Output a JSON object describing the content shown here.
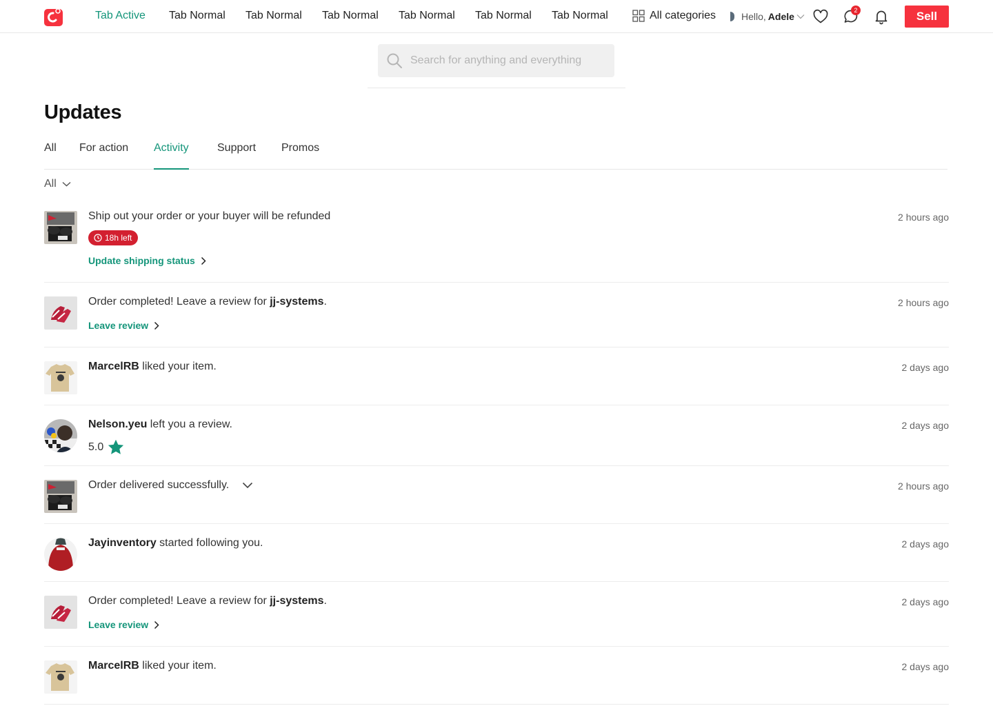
{
  "nav": {
    "tabs": [
      "Tab Active",
      "Tab Normal",
      "Tab Normal",
      "Tab Normal",
      "Tab Normal",
      "Tab Normal",
      "Tab Normal"
    ],
    "categories_label": "All categories",
    "hello_prefix": "Hello,",
    "user_name": "Adele",
    "chat_badge": "2",
    "sell_label": "Sell"
  },
  "search": {
    "placeholder": "Search for anything and everything"
  },
  "page": {
    "title": "Updates",
    "tabs": [
      "All",
      "For action",
      "Activity",
      "Support",
      "Promos"
    ],
    "active_tab": "Activity",
    "filter_label": "All"
  },
  "feed": [
    {
      "text": "Ship out your order or your buyer will be refunded",
      "timer": "18h left",
      "action": "Update shipping status",
      "time": "2 hours ago",
      "thumb": "sneaker-box-photo"
    },
    {
      "pre": "Order completed! Leave a review for ",
      "bold": "jj-systems",
      "post": ".",
      "action": "Leave review",
      "time": "2 hours ago",
      "thumb": "red-sneakers-photo"
    },
    {
      "bold": "MarcelRB",
      "post": " liked your item.",
      "time": "2 days ago",
      "thumb": "tshirt-photo"
    },
    {
      "bold": "Nelson.yeu",
      "post": " left you a review.",
      "rating": "5.0",
      "time": "2 days ago",
      "thumb": "user-avatar-photo"
    },
    {
      "text": "Order delivered successfully.",
      "time": "2 hours ago",
      "thumb": "sneaker-box-photo"
    },
    {
      "bold": "Jayinventory",
      "post": " started following you.",
      "time": "2 days ago",
      "thumb": "red-jacket-avatar"
    },
    {
      "pre": "Order completed! Leave a review for ",
      "bold": "jj-systems",
      "post": ".",
      "action": "Leave review",
      "time": "2 days ago",
      "thumb": "red-sneakers-photo"
    },
    {
      "bold": "MarcelRB",
      "post": " liked your item.",
      "time": "2 days ago",
      "thumb": "tshirt-photo"
    }
  ],
  "colors": {
    "accent": "#14957a",
    "brand_red": "#f6323e",
    "timer_red": "#d32030",
    "star": "#14957a"
  }
}
